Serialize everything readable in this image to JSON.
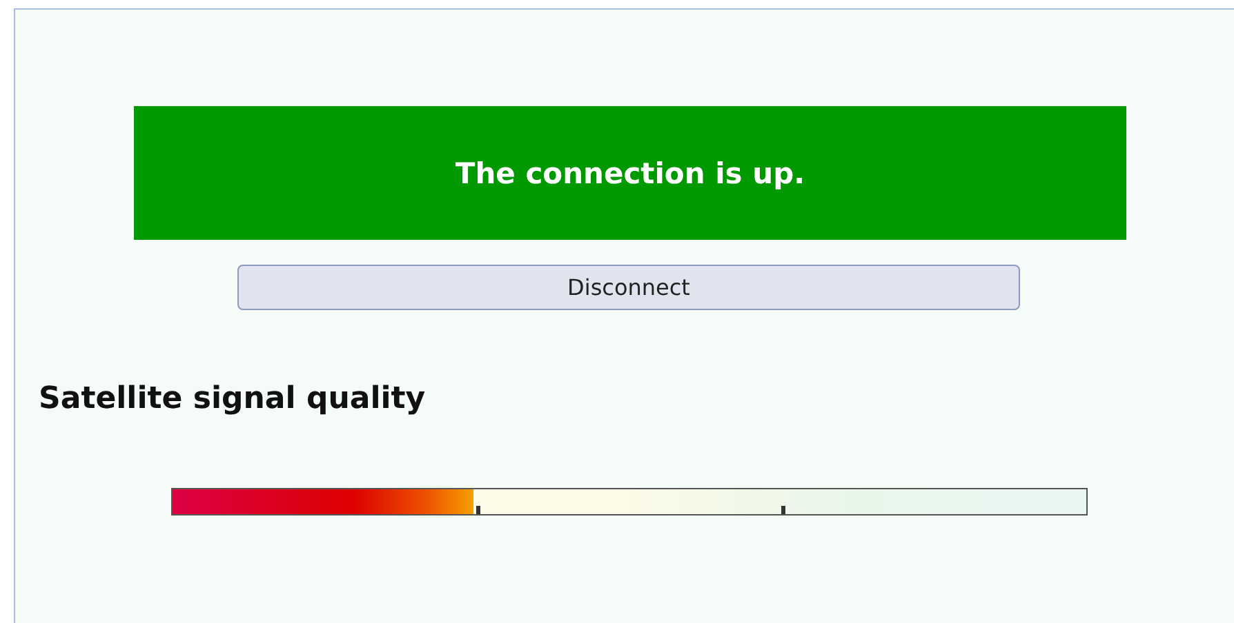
{
  "status": {
    "text": "The connection is up.",
    "connected": true
  },
  "buttons": [
    "Disconnect"
  ],
  "signal": {
    "title": "Satellite signal quality",
    "level": 0.33
  }
}
